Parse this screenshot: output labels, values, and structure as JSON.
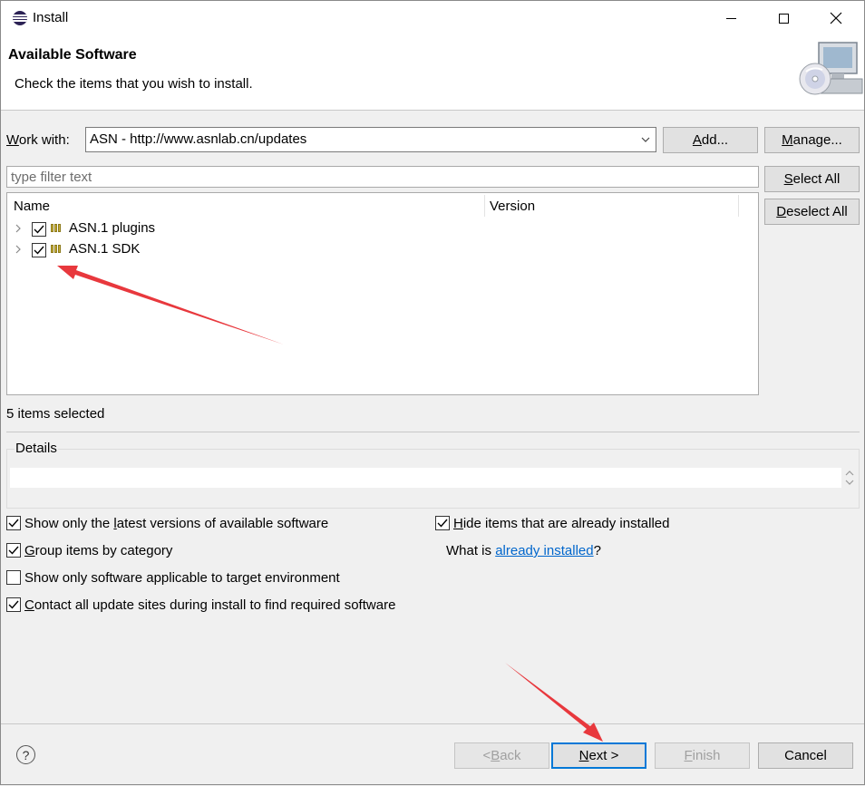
{
  "window": {
    "title": "Install"
  },
  "header": {
    "title": "Available Software",
    "description": "Check the items that you wish to install."
  },
  "work_with": {
    "label": "Work with:",
    "value": "ASN - http://www.asnlab.cn/updates",
    "add_label": "Add...",
    "manage_label": "Manage..."
  },
  "filter": {
    "placeholder": "type filter text"
  },
  "side_buttons": {
    "select_all": "Select All",
    "deselect_all": "Deselect All"
  },
  "tree": {
    "columns": [
      "Name",
      "Version"
    ],
    "items": [
      {
        "label": "ASN.1 plugins",
        "checked": true
      },
      {
        "label": "ASN.1 SDK",
        "checked": true
      }
    ]
  },
  "status": {
    "selected": "5 items selected"
  },
  "details": {
    "label": "Details"
  },
  "options": {
    "latest_versions": {
      "label": "Show only the latest versions of available software",
      "checked": true
    },
    "group_by_category": {
      "label": "Group items by category",
      "checked": true
    },
    "target_env": {
      "label": "Show only software applicable to target environment",
      "checked": false
    },
    "contact_sites": {
      "label": "Contact all update sites during install to find required software",
      "checked": true
    },
    "hide_installed": {
      "label": "Hide items that are already installed",
      "checked": true
    },
    "what_is_prefix": "What is ",
    "what_is_link": "already installed",
    "what_is_suffix": "?"
  },
  "footer": {
    "back": "< Back",
    "next": "Next >",
    "finish": "Finish",
    "cancel": "Cancel",
    "help": "?"
  },
  "colors": {
    "accent": "#0078d7",
    "annotation_arrow": "#e8383d",
    "link": "#0066cc"
  },
  "icons": {
    "app": "eclipse-icon",
    "banner": "install-wizard-icon",
    "feature": "feature-icon",
    "help": "help-icon"
  }
}
